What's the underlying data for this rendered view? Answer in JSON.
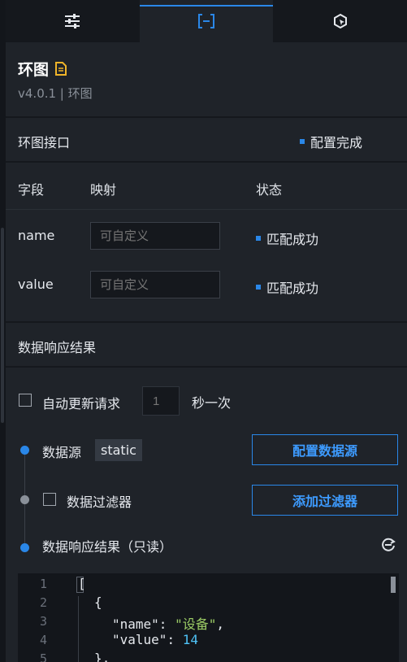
{
  "tabs": [
    {
      "icon": "sliders-icon"
    },
    {
      "icon": "bracket-minus-icon"
    },
    {
      "icon": "cursor-refresh-icon"
    }
  ],
  "header": {
    "title": "环图",
    "version": "v4.0.1 | 环图",
    "title_icon": "document-icon",
    "title_icon_color": "#f0b429"
  },
  "interface": {
    "title": "环图接口",
    "status": "配置完成"
  },
  "mapping": {
    "columns": [
      "字段",
      "映射",
      "状态"
    ],
    "rows": [
      {
        "field": "name",
        "placeholder": "可自定义",
        "status": "匹配成功"
      },
      {
        "field": "value",
        "placeholder": "可自定义",
        "status": "匹配成功"
      }
    ]
  },
  "response": {
    "title": "数据响应结果",
    "auto_update_label": "自动更新请求",
    "interval_value": "1",
    "interval_unit": "秒一次",
    "datasource_label": "数据源",
    "datasource_value": "static",
    "config_button": "配置数据源",
    "filter_label": "数据过滤器",
    "filter_button": "添加过滤器",
    "result_label": "数据响应结果（只读）"
  },
  "editor": {
    "line_numbers": [
      "1",
      "2",
      "3",
      "4",
      "5"
    ],
    "line1": "[",
    "line2": "{",
    "key_name": "\"name\"",
    "colon": ": ",
    "val_name": "\"设备\"",
    "comma": ",",
    "key_value": "\"value\"",
    "val_value": "14",
    "line5": "},"
  },
  "colors": {
    "accent": "#2a87e8",
    "background": "#1f2329",
    "string": "#9ccc65",
    "number": "#4fc3f7"
  }
}
